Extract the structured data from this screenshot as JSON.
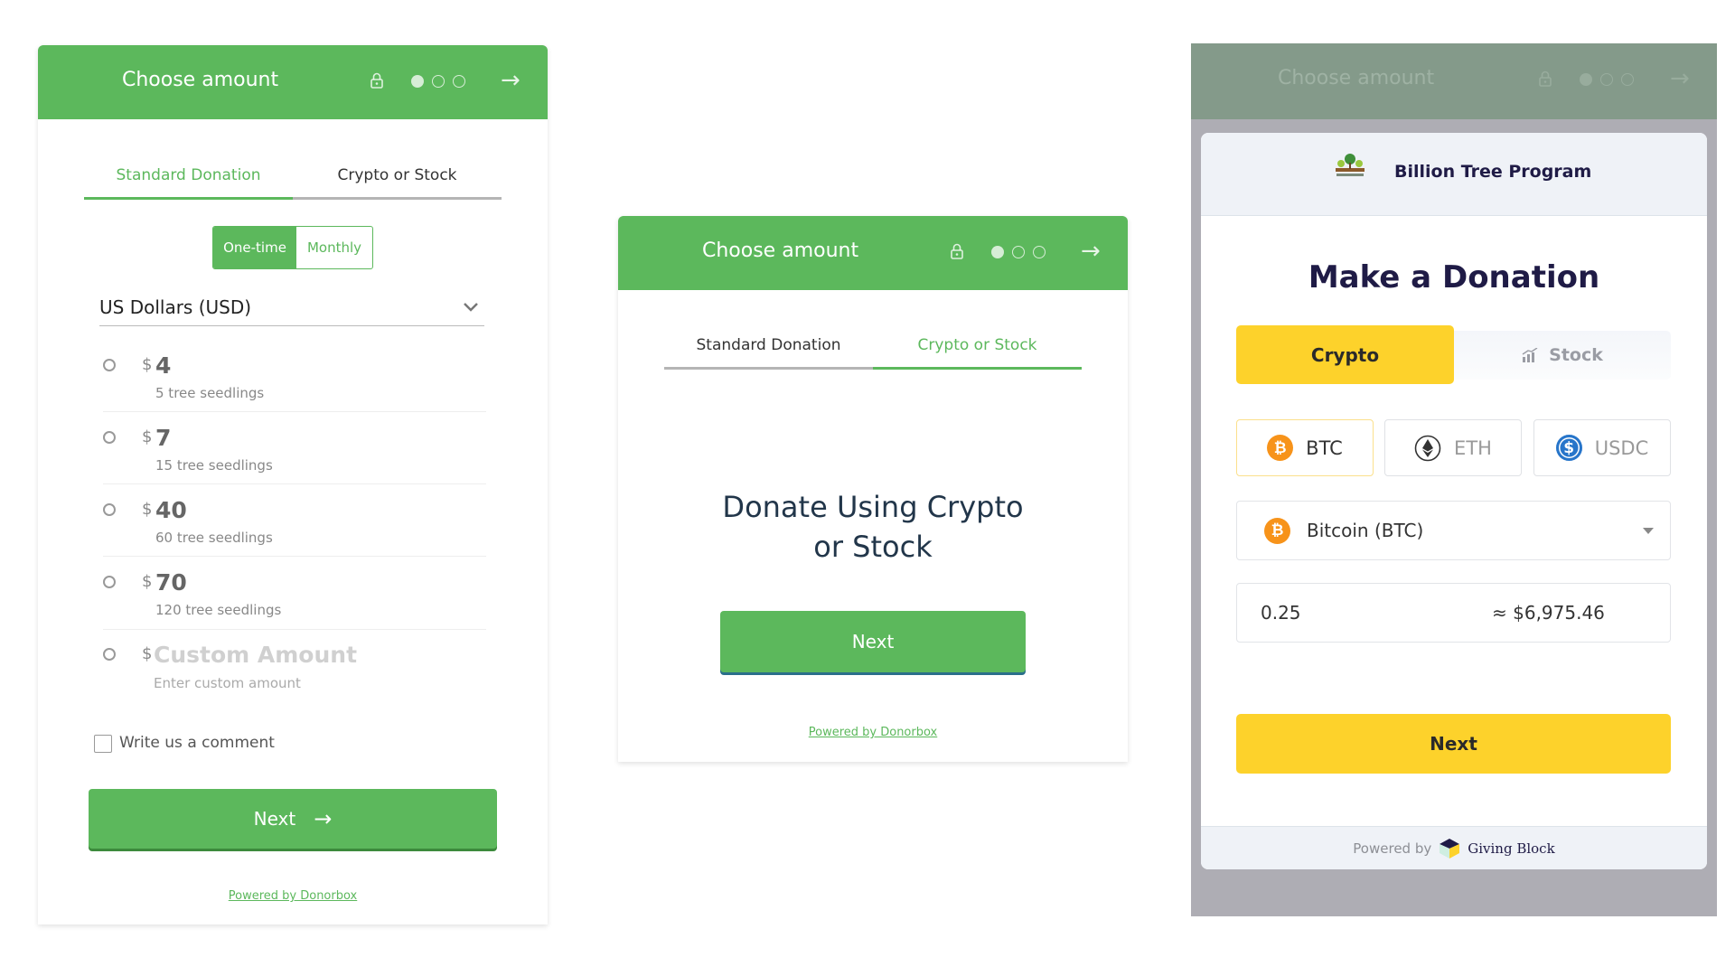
{
  "left": {
    "header": {
      "title": "Choose amount",
      "arrow": "→",
      "steps_total": 3,
      "steps_active": 1
    },
    "tabs": [
      {
        "label": "Standard Donation",
        "active": true
      },
      {
        "label": "Crypto or Stock",
        "active": false
      }
    ],
    "frequency": {
      "options": [
        "One-time",
        "Monthly"
      ],
      "selected": "One-time"
    },
    "currency": {
      "selected": "US Dollars (USD)"
    },
    "amounts": [
      {
        "symbol": "$",
        "value": "4",
        "desc": "5 tree seedlings"
      },
      {
        "symbol": "$",
        "value": "7",
        "desc": "15 tree seedlings"
      },
      {
        "symbol": "$",
        "value": "40",
        "desc": "60 tree seedlings"
      },
      {
        "symbol": "$",
        "value": "70",
        "desc": "120 tree seedlings"
      }
    ],
    "custom": {
      "symbol": "$",
      "placeholder": "Custom Amount",
      "desc": "Enter custom amount"
    },
    "comment_label": "Write us a comment",
    "next_label": "Next",
    "next_arrow": "→",
    "powered_by": "Powered by Donorbox",
    "colors": {
      "accent": "#5cb85c"
    }
  },
  "middle": {
    "header": {
      "title": "Choose amount",
      "arrow": "→"
    },
    "tabs": [
      {
        "label": "Standard Donation",
        "active": false
      },
      {
        "label": "Crypto or Stock",
        "active": true
      }
    ],
    "headline_line1": "Donate Using Crypto",
    "headline_line2": "or Stock",
    "next_label": "Next",
    "powered_by": "Powered by Donorbox"
  },
  "right": {
    "header": {
      "title": "Choose amount",
      "arrow": "→"
    },
    "org_name": "Billion Tree Program",
    "title": "Make a Donation",
    "segments": [
      {
        "label": "Crypto",
        "active": true
      },
      {
        "label": "Stock",
        "active": false
      }
    ],
    "coins": [
      {
        "label": "BTC",
        "icon": "bitcoin-icon",
        "color": "#f7931a",
        "selected": true
      },
      {
        "label": "ETH",
        "icon": "ethereum-icon",
        "color": "#333333",
        "selected": false
      },
      {
        "label": "USDC",
        "icon": "usdc-icon",
        "color": "#2775ca",
        "selected": false
      }
    ],
    "select": {
      "value": "Bitcoin (BTC)"
    },
    "amount": {
      "value": "0.25",
      "approx": "≈ $6,975.46"
    },
    "next_label": "Next",
    "footer": {
      "prefix": "Powered by",
      "brand": "Giving Block"
    },
    "colors": {
      "accent": "#fdd22b",
      "title": "#1f1b46"
    }
  }
}
